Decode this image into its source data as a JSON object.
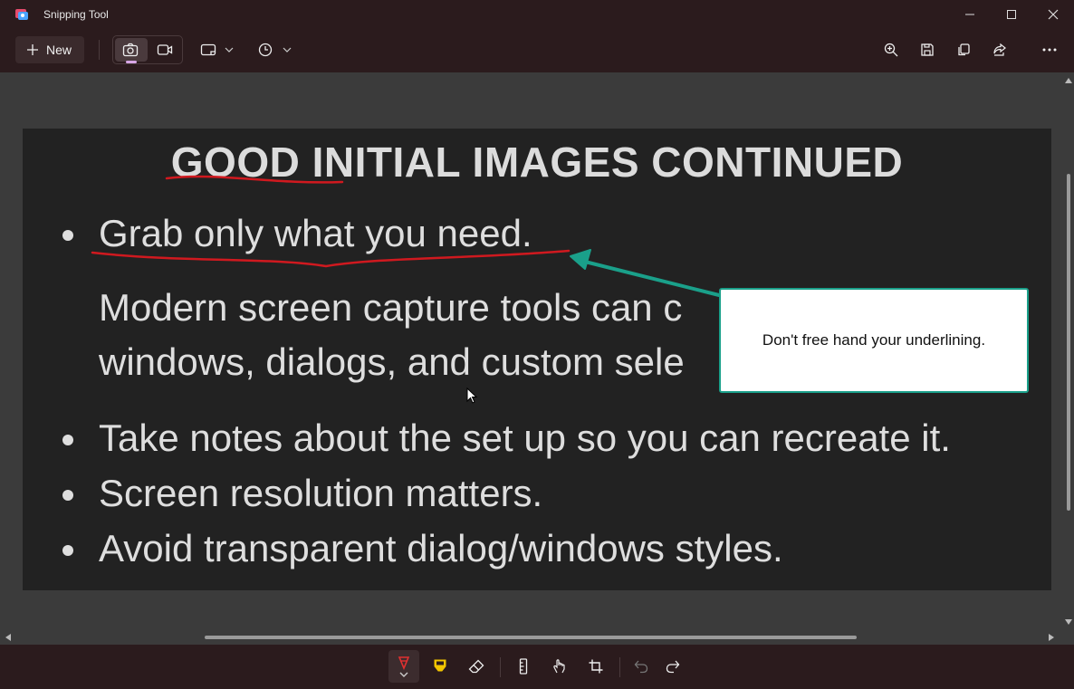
{
  "window": {
    "title": "Snipping Tool"
  },
  "toolbar": {
    "new_label": "New",
    "icons": [
      "camera-icon",
      "video-icon",
      "rectangle-mode-icon",
      "chevron-down-icon",
      "timer-icon",
      "chevron-down-icon",
      "zoom-icon",
      "save-icon",
      "copy-icon",
      "share-icon",
      "more-icon"
    ]
  },
  "snip": {
    "title": "GOOD INITIAL IMAGES CONTINUED",
    "bullets": [
      "Grab only what you need.",
      "Take notes about the set up so you can recreate it.",
      "Screen resolution matters.",
      "Avoid transparent dialog/windows styles."
    ],
    "paragraph_lines": [
      "Modern screen capture tools can c",
      "windows, dialogs, and custom sele"
    ],
    "callout": "Don't free hand your underlining."
  },
  "colors": {
    "chrome": "#2b1b1d",
    "canvas": "#3b3b3b",
    "ink_red": "#d0191f",
    "arrow_teal": "#1aa08a",
    "pen_indicator": "#d8a7e6"
  },
  "bottom_tools": [
    "ballpoint-pen-icon",
    "highlighter-icon",
    "eraser-icon",
    "ruler-icon",
    "touch-writing-icon",
    "crop-icon",
    "undo-icon",
    "redo-icon"
  ]
}
